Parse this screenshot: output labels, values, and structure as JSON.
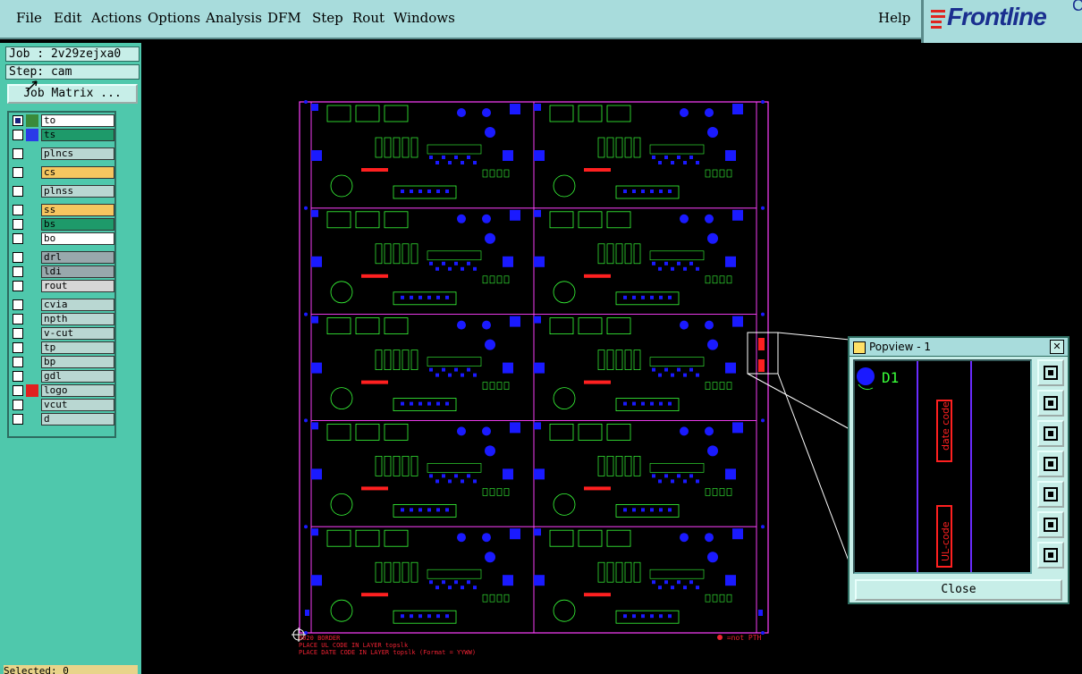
{
  "menu": {
    "items": [
      "File",
      "Edit",
      "Actions",
      "Options",
      "Analysis",
      "DFM",
      "Step",
      "Rout",
      "Windows"
    ],
    "help": "Help"
  },
  "brand": {
    "name": "Frontline",
    "suffix": "C"
  },
  "job": {
    "label": "Job : 2v29zejxa0"
  },
  "step": {
    "label": "Step: cam"
  },
  "job_matrix_button": "Job Matrix ...",
  "layers": [
    {
      "name": "to",
      "color": "#ffffff",
      "swatch": "#3a8a3a",
      "checked": true
    },
    {
      "name": "ts",
      "color": "#1e9a6a",
      "swatch": "#2a3ae8",
      "checked": false
    },
    {
      "name": "plncs",
      "color": "#b9d7d2",
      "swatch": "",
      "checked": false
    },
    {
      "name": "cs",
      "color": "#f6c660",
      "swatch": "",
      "checked": false
    },
    {
      "name": "plnss",
      "color": "#b9d7d2",
      "swatch": "",
      "checked": false
    },
    {
      "name": "ss",
      "color": "#f6c660",
      "swatch": "",
      "checked": false
    },
    {
      "name": "bs",
      "color": "#1e9a6a",
      "swatch": "",
      "checked": false
    },
    {
      "name": "bo",
      "color": "#ffffff",
      "swatch": "",
      "checked": false
    },
    {
      "name": "drl",
      "color": "#98a8ac",
      "swatch": "",
      "checked": false
    },
    {
      "name": "ldi",
      "color": "#98a8ac",
      "swatch": "",
      "checked": false
    },
    {
      "name": "rout",
      "color": "#d6d6d6",
      "swatch": "",
      "checked": false
    },
    {
      "name": "cvia",
      "color": "#b9d7d2",
      "swatch": "",
      "checked": false
    },
    {
      "name": "npth",
      "color": "#b9d7d2",
      "swatch": "",
      "checked": false
    },
    {
      "name": "v-cut",
      "color": "#b9d7d2",
      "swatch": "",
      "checked": false
    },
    {
      "name": "tp",
      "color": "#b9d7d2",
      "swatch": "",
      "checked": false
    },
    {
      "name": "bp",
      "color": "#b9d7d2",
      "swatch": "",
      "checked": false
    },
    {
      "name": "gdl",
      "color": "#b9d7d2",
      "swatch": "",
      "checked": false
    },
    {
      "name": "logo",
      "color": "#b9d7d2",
      "swatch": "#e02020",
      "checked": false
    },
    {
      "name": "vcut",
      "color": "#b9d7d2",
      "swatch": "",
      "checked": false
    },
    {
      "name": "d",
      "color": "#b9d7d2",
      "swatch": "",
      "checked": false
    }
  ],
  "status": {
    "text": "Selected: 0"
  },
  "board": {
    "notes": [
      "0020  BORDER",
      "PLACE UL CODE IN LAYER topslk",
      "PLACE DATE CODE IN LAYER topslk (Format = YYWW)"
    ],
    "not_pth": "=not PTH"
  },
  "popview": {
    "title": "Popview - 1",
    "close_x": "✕",
    "pad_label": "D1",
    "date_code": "date code",
    "ul_code": "UL-code",
    "tools": [
      "zoom-window",
      "pan-up",
      "pan-down",
      "pan-left",
      "pan-right",
      "zoom-fit",
      "zoom-center"
    ],
    "close_button": "Close"
  },
  "colors": {
    "cyan": "#a8dcdc",
    "sidebar": "#4fc8ac",
    "pad": "#1a1aff",
    "outline": "#39ff39",
    "frame": "#ff40ff",
    "red": "#ff2020"
  }
}
